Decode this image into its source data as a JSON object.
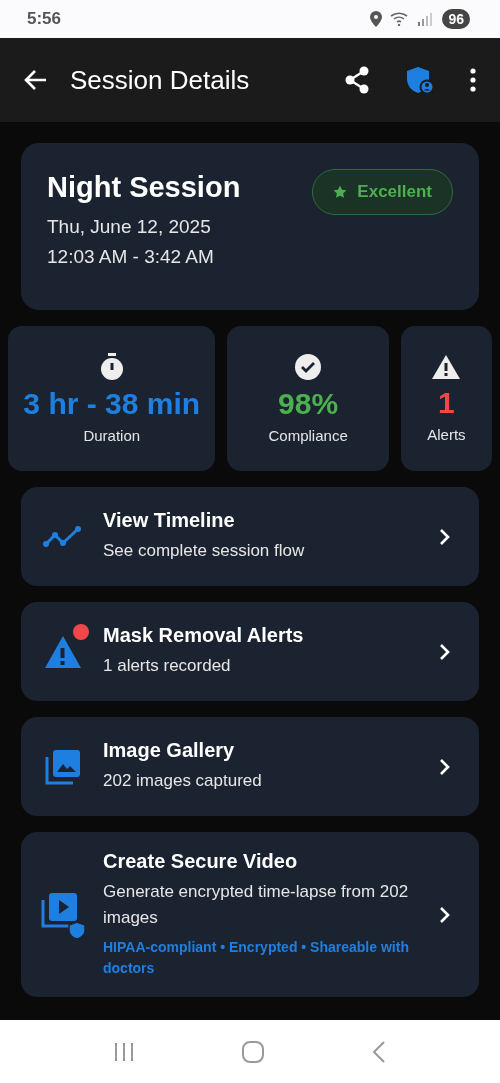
{
  "status_bar": {
    "time": "5:56",
    "battery": "96"
  },
  "app_bar": {
    "title": "Session Details"
  },
  "session": {
    "title": "Night Session",
    "rating": "Excellent",
    "date": "Thu, June 12, 2025",
    "time_range": "12:03 AM - 3:42 AM"
  },
  "stats": [
    {
      "kind": "duration",
      "value": "3 hr - 38 min",
      "label": "Duration",
      "color": "#1e7fe0"
    },
    {
      "kind": "compliance",
      "value": "98%",
      "label": "Compliance",
      "color": "#4caf50"
    },
    {
      "kind": "alerts",
      "value": "1",
      "label": "Alerts",
      "color": "#f04848"
    }
  ],
  "actions": [
    {
      "kind": "timeline",
      "title": "View Timeline",
      "subtitle": "See complete session flow",
      "badge": false
    },
    {
      "kind": "alerts",
      "title": "Mask Removal Alerts",
      "subtitle": "1 alerts recorded",
      "badge": true
    },
    {
      "kind": "gallery",
      "title": "Image Gallery",
      "subtitle": "202 images captured",
      "badge": false
    },
    {
      "kind": "video",
      "title": "Create Secure Video",
      "subtitle": "Generate encrypted time-lapse from 202 images",
      "note": "HIPAA-compliant • Encrypted • Shareable with doctors",
      "badge": false
    }
  ]
}
